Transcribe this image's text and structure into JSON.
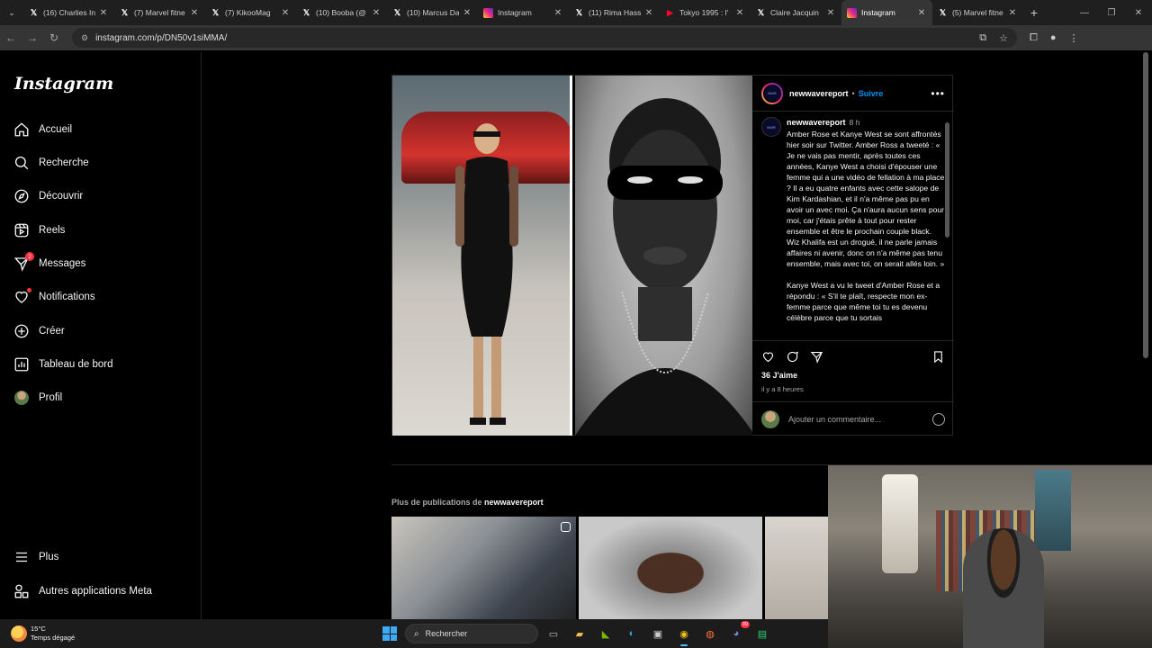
{
  "browser": {
    "tabs": [
      {
        "label": "(16) Charlies In",
        "icon": "x-logo-icon",
        "active": false
      },
      {
        "label": "(7) Marvel fitne",
        "icon": "x-logo-icon",
        "active": false
      },
      {
        "label": "(7) KikooMag",
        "icon": "x-logo-icon",
        "active": false
      },
      {
        "label": "(10) Booba (@",
        "icon": "x-logo-icon",
        "active": false
      },
      {
        "label": "(10) Marcus Da",
        "icon": "x-logo-icon",
        "active": false
      },
      {
        "label": "Instagram",
        "icon": "instagram-icon",
        "active": false
      },
      {
        "label": "(11) Rima Hass",
        "icon": "x-logo-icon",
        "active": false
      },
      {
        "label": "Tokyo 1995 : l'",
        "icon": "youtube-icon",
        "active": false
      },
      {
        "label": "Claire Jacquin",
        "icon": "x-logo-icon",
        "active": false
      },
      {
        "label": "Instagram",
        "icon": "instagram-icon",
        "active": true
      },
      {
        "label": "(5) Marvel fitne",
        "icon": "x-logo-icon",
        "active": false
      }
    ],
    "url": "instagram.com/p/DN50v1siMMA/"
  },
  "sidebar": {
    "logo": "Instagram",
    "items": [
      {
        "label": "Accueil",
        "icon": "home-icon"
      },
      {
        "label": "Recherche",
        "icon": "search-icon"
      },
      {
        "label": "Découvrir",
        "icon": "compass-icon"
      },
      {
        "label": "Reels",
        "icon": "reels-icon"
      },
      {
        "label": "Messages",
        "icon": "messenger-icon",
        "badge": "2"
      },
      {
        "label": "Notifications",
        "icon": "heart-icon"
      },
      {
        "label": "Créer",
        "icon": "plus-square-icon"
      },
      {
        "label": "Tableau de bord",
        "icon": "dashboard-icon"
      },
      {
        "label": "Profil",
        "icon": "avatar"
      }
    ],
    "bottom": [
      {
        "label": "Plus",
        "icon": "menu-icon"
      },
      {
        "label": "Autres applications Meta",
        "icon": "meta-apps-icon"
      }
    ]
  },
  "post": {
    "account": "newwavereport",
    "follow_sep": "•",
    "follow": "Suivre",
    "more": "•••",
    "caption_time": "8 h",
    "caption_p1": "Amber Rose et Kanye West se sont affrontés hier soir sur Twitter. Amber Ross a tweeté : « Je ne vais pas mentir, après toutes ces années, Kanye West a choisi d'épouser une femme qui a une vidéo de fellation à ma place ? Il a eu quatre enfants avec cette salope de Kim Kardashian, et il n'a même pas pu en avoir un avec moi. Ça n'aura aucun sens pour moi, car j'étais prête à tout pour rester ensemble et être le prochain couple black. Wiz Khalifa est un drogué, il ne parle jamais affaires ni avenir, donc on n'a même pas tenu ensemble, mais avec toi, on serait allés loin. »",
    "caption_p2": "Kanye West a vu le tweet d'Amber Rose et a répondu : « S'il te plaît, respecte mon ex-femme parce que même toi tu es devenu célèbre parce que tu sortais",
    "likes": "36 J'aime",
    "time_ago": "il y a 8 heures",
    "comment_placeholder": "Ajouter un commentaire..."
  },
  "more_posts": {
    "prefix": "Plus de publications de",
    "account": "newwavereport"
  },
  "taskbar": {
    "temperature": "15°C",
    "weather": "Temps dégagé",
    "search_label": "Rechercher",
    "discord_badge": "99"
  }
}
